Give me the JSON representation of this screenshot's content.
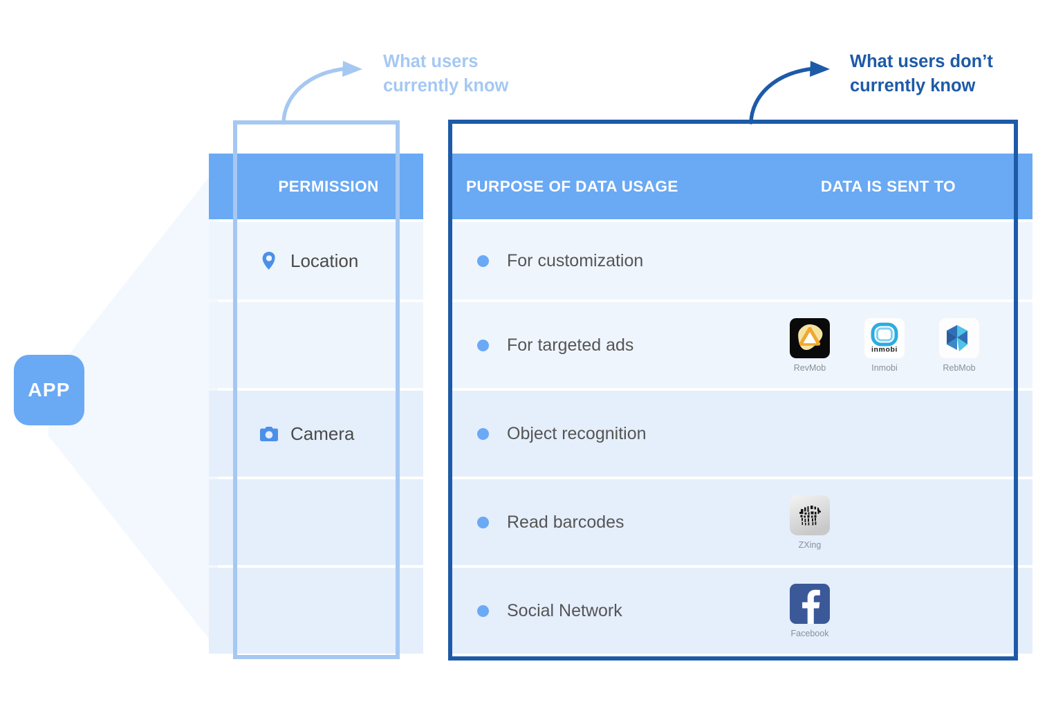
{
  "app_badge": {
    "label": "APP"
  },
  "callouts": {
    "left": {
      "text": "What users\ncurrently know",
      "color": "#a5c8f2"
    },
    "right": {
      "text": "What users don’t\ncurrently know",
      "color": "#1d5aa8"
    }
  },
  "table": {
    "headers": {
      "permission": "PERMISSION",
      "purpose": "PURPOSE OF DATA USAGE",
      "sent_to": "DATA IS SENT TO"
    },
    "permissions": [
      {
        "label": "Location",
        "icon": "map-pin-icon"
      },
      {
        "label": "Camera",
        "icon": "camera-icon"
      }
    ],
    "rows": [
      {
        "purpose": "For customization",
        "destinations": []
      },
      {
        "purpose": "For targeted ads",
        "destinations": [
          {
            "name": "RevMob",
            "icon": "revmob-icon"
          },
          {
            "name": "Inmobi",
            "icon": "inmobi-icon"
          },
          {
            "name": "RebMob",
            "icon": "rebmob-icon"
          }
        ]
      },
      {
        "purpose": "Object recognition",
        "destinations": []
      },
      {
        "purpose": "Read barcodes",
        "destinations": [
          {
            "name": "ZXing",
            "icon": "zxing-icon"
          }
        ]
      },
      {
        "purpose": "Social Network",
        "destinations": [
          {
            "name": "Facebook",
            "icon": "facebook-icon"
          }
        ]
      }
    ]
  },
  "colors": {
    "header_blue": "#6aa9f4",
    "row_light": "#eff5fd",
    "row_dark": "#e5eefb",
    "accent_light": "#a5c8f2",
    "accent_dark": "#1d5aa8"
  }
}
